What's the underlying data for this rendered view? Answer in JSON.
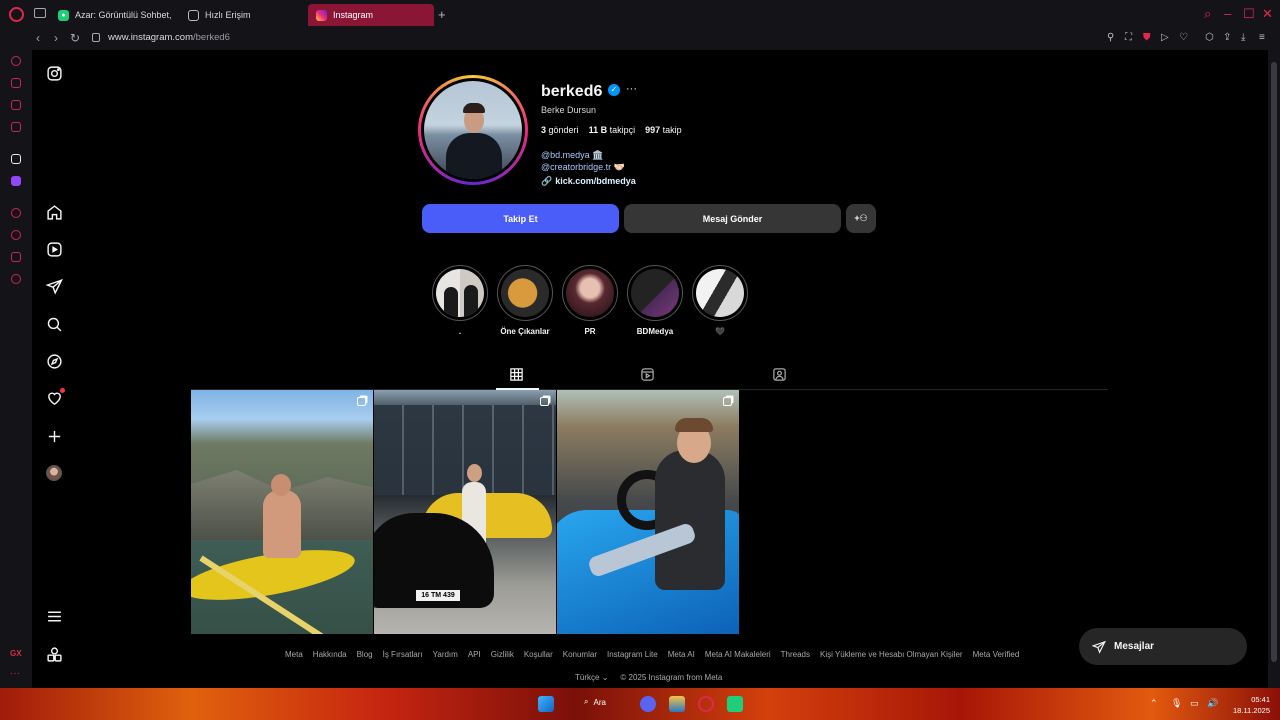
{
  "browser": {
    "tabs": [
      {
        "label": "Azar: Görüntülü Sohbet, V",
        "favicon": "azar-icon",
        "active": false
      },
      {
        "label": "Hızlı Erişim",
        "favicon": "grid-icon",
        "active": false
      },
      {
        "label": "Instagram",
        "favicon": "instagram-icon",
        "active": true
      }
    ],
    "url_host": "www.instagram.com",
    "url_path": "/berked6",
    "accent_color": "#e0274f"
  },
  "instagram_nav": [
    {
      "name": "instagram-logo-icon"
    },
    {
      "name": "home-icon"
    },
    {
      "name": "reels-icon"
    },
    {
      "name": "direct-icon"
    },
    {
      "name": "search-icon"
    },
    {
      "name": "explore-icon"
    },
    {
      "name": "notifications-heart-icon",
      "has_badge": true
    },
    {
      "name": "create-plus-icon"
    },
    {
      "name": "profile-avatar"
    },
    {
      "name": "menu-icon"
    },
    {
      "name": "also-from-meta-icon"
    }
  ],
  "profile": {
    "username": "berked6",
    "verified": true,
    "full_name": "Berke Dursun",
    "posts_count": "3",
    "posts_label": "gönderi",
    "followers_count": "11 B",
    "followers_label": "takipçi",
    "following_count": "997",
    "following_label": "takip",
    "bio": [
      {
        "text": "@bd.medya",
        "emoji": "🏛️"
      },
      {
        "text": "@creatorbridge.tr",
        "emoji": "🤝🏻"
      }
    ],
    "link": "kick.com/bdmedya"
  },
  "actions": {
    "follow": "Takip Et",
    "message": "Mesaj Gönder",
    "follow_color": "#4a5df9"
  },
  "highlights": [
    {
      "label": "."
    },
    {
      "label": "Öne Çıkanlar"
    },
    {
      "label": "PR"
    },
    {
      "label": "BDMedya"
    },
    {
      "label": "🖤"
    }
  ],
  "profile_tabs": [
    {
      "name": "posts-grid-tab",
      "active": true
    },
    {
      "name": "reels-tab",
      "active": false
    },
    {
      "name": "tagged-tab",
      "active": false
    }
  ],
  "posts": [
    {
      "type": "carousel"
    },
    {
      "type": "carousel",
      "plate_text": "16 TM 439"
    },
    {
      "type": "carousel"
    }
  ],
  "footer": {
    "links": [
      "Meta",
      "Hakkında",
      "Blog",
      "İş Fırsatları",
      "Yardım",
      "API",
      "Gizlilik",
      "Koşullar",
      "Konumlar",
      "Instagram Lite",
      "Meta AI",
      "Meta AI Makaleleri",
      "Threads",
      "Kişi Yükleme ve Hesabı Olmayan Kişiler",
      "Meta Verified"
    ],
    "language": "Türkçe",
    "copyright": "© 2025 Instagram from Meta"
  },
  "messages_button": "Mesajlar",
  "taskbar": {
    "search_label": "Ara",
    "time": "05:41",
    "date": "18.11.2025"
  }
}
